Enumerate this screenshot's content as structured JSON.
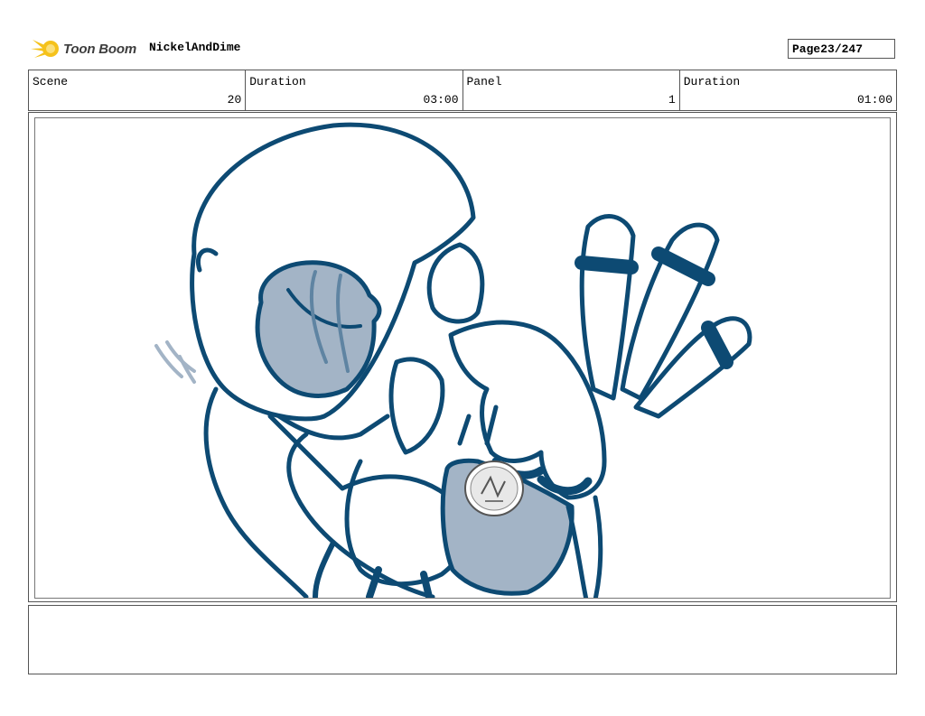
{
  "header": {
    "logo_text": "Toon Boom",
    "project_name": "NickelAndDime",
    "page_label": "Page",
    "page_value": "23/247"
  },
  "info": {
    "scene_label": "Scene",
    "scene_value": "20",
    "scene_duration_label": "Duration",
    "scene_duration_value": "03:00",
    "panel_label": "Panel",
    "panel_value": "1",
    "panel_duration_label": "Duration",
    "panel_duration_value": "01:00"
  },
  "colors": {
    "ink": "#0d4a73",
    "shade": "#a3b4c6",
    "logo_yellow": "#f5c21b"
  },
  "icons": [
    "toon-boom-logo-icon",
    "coin-icon"
  ]
}
